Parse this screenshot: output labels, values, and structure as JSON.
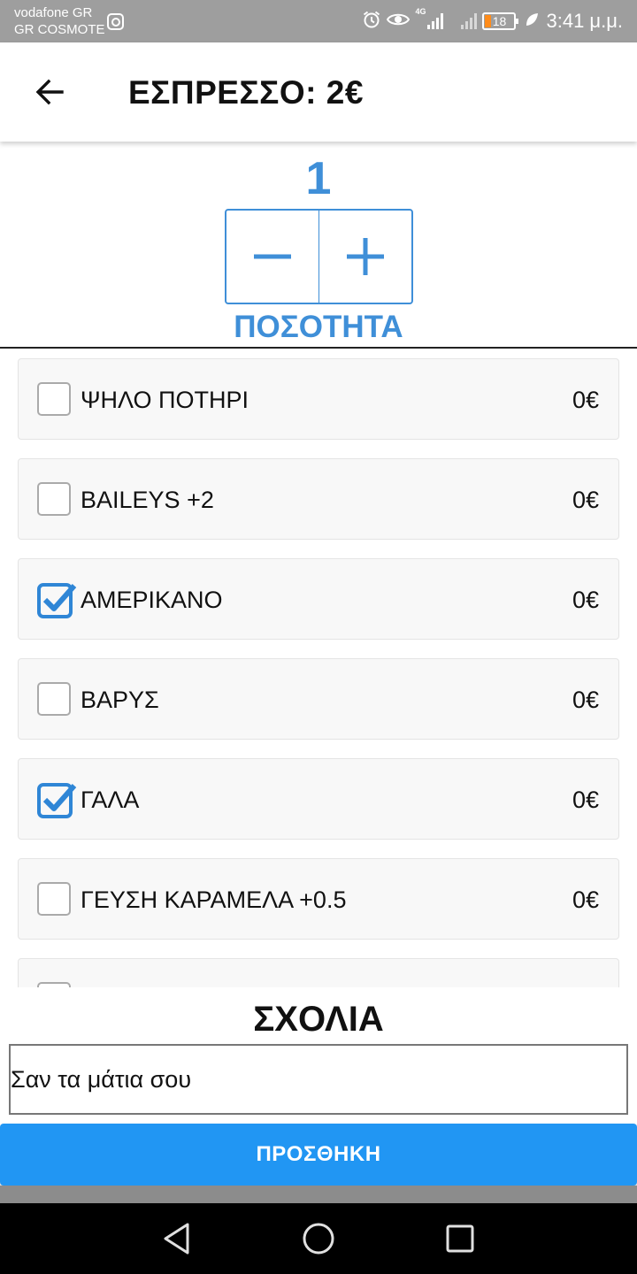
{
  "status_bar": {
    "carrier_1": "vodafone GR",
    "carrier_2": "GR COSMOTE",
    "network_type": "4G",
    "battery": "18",
    "time": "3:41 μ.μ.",
    "icons": [
      "instagram-icon",
      "alarm-icon",
      "eye-icon",
      "signal-icon",
      "battery-icon",
      "leaf-icon"
    ]
  },
  "header": {
    "title": "ΕΣΠΡΕΣΣΟ: 2€"
  },
  "quantity": {
    "value": "1",
    "label": "ΠΟΣΟΤΗΤΑ"
  },
  "options": [
    {
      "label": "ΨΗΛΟ ΠΟΤΗΡΙ",
      "price": "0€",
      "checked": false
    },
    {
      "label": "BAILEYS +2",
      "price": "0€",
      "checked": false
    },
    {
      "label": "ΑΜΕΡΙΚΑΝΟ",
      "price": "0€",
      "checked": true
    },
    {
      "label": "ΒΑΡΥΣ",
      "price": "0€",
      "checked": false
    },
    {
      "label": "ΓΑΛΑ",
      "price": "0€",
      "checked": true
    },
    {
      "label": "ΓΕΥΣΗ ΚΑΡΑΜΕΛΑ +0.5",
      "price": "0€",
      "checked": false
    }
  ],
  "comments": {
    "title": "ΣΧΟΛΙΑ",
    "value": "Σαν τα μάτια σου"
  },
  "actions": {
    "add_label": "ΠΡΟΣΘΗΚΗ"
  },
  "colors": {
    "accent": "#3f8fd8",
    "button": "#2196f3",
    "status_bar": "#9e9e9e",
    "nav_bar": "#000000"
  }
}
